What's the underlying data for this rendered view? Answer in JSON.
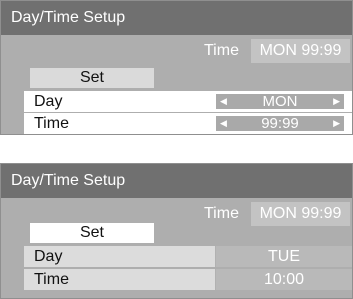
{
  "screens": [
    {
      "title": "Day/Time Setup",
      "current_label": "Time",
      "current_value": "MON  99:99",
      "set_label": "Set",
      "day_label": "Day",
      "day_value": "MON",
      "time_label": "Time",
      "time_value": "99:99",
      "left_arrow_icon": "left-triangle-icon",
      "right_arrow_icon": "right-triangle-icon"
    },
    {
      "title": "Day/Time Setup",
      "current_label": "Time",
      "current_value": "MON  99:99",
      "set_label": "Set",
      "day_label": "Day",
      "day_value": "TUE",
      "time_label": "Time",
      "time_value": "10:00"
    }
  ],
  "colors": {
    "title_bar": "#707070",
    "panel_bg": "#aeaeae",
    "highlight": "#ffffff"
  }
}
